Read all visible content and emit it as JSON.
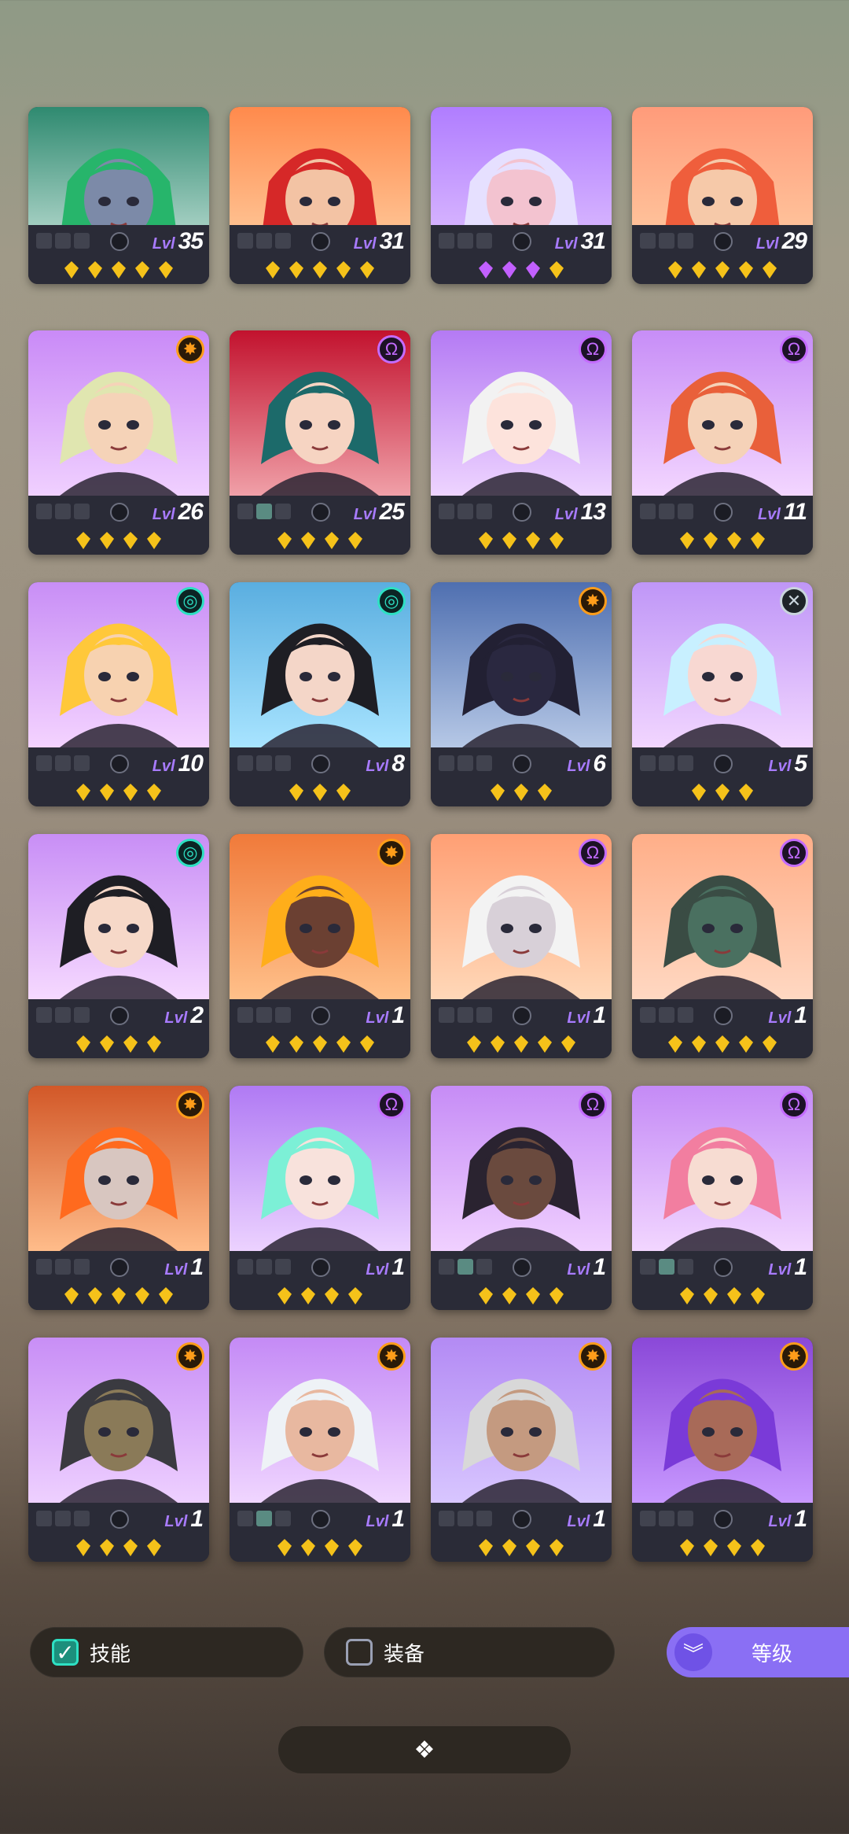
{
  "lvl_prefix": "Lvl",
  "cards": [
    {
      "level": "35",
      "faction": "none",
      "faction_icon": "",
      "stars": 5,
      "star_color": "#f5c21a",
      "gear": 0,
      "bg": [
        "#2f8a70",
        "#cfe8e0"
      ],
      "hair": "#27b56b",
      "skin": "#7c8aa8",
      "crop": true
    },
    {
      "level": "31",
      "faction": "none",
      "faction_icon": "",
      "stars": 5,
      "star_color": "#f5c21a",
      "gear": 0,
      "bg": [
        "#ff8a4c",
        "#ffd4a8"
      ],
      "hair": "#d62828",
      "skin": "#f3c3a4",
      "crop": true
    },
    {
      "level": "31",
      "faction": "none",
      "faction_icon": "",
      "stars": 4,
      "star_color": "mixed",
      "gear": 0,
      "bg": [
        "#b07dff",
        "#e3c6ff"
      ],
      "hair": "#e6e0ff",
      "skin": "#f3c3d0",
      "crop": true
    },
    {
      "level": "29",
      "faction": "none",
      "faction_icon": "",
      "stars": 5,
      "star_color": "#f5c21a",
      "gear": 0,
      "bg": [
        "#ff9b7a",
        "#ffd0a6"
      ],
      "hair": "#ef5e3c",
      "skin": "#f6c9a9",
      "crop": true
    },
    {
      "level": "26",
      "faction": "orange",
      "faction_icon": "✸",
      "stars": 4,
      "star_color": "#f5c21a",
      "gear": 0,
      "bg": [
        "#c98af7",
        "#f0d0ff"
      ],
      "hair": "#e0e6b0",
      "skin": "#f5d3b8"
    },
    {
      "level": "25",
      "faction": "purple",
      "faction_icon": "Ω",
      "stars": 4,
      "star_color": "#f5c21a",
      "gear": 2,
      "bg": [
        "#c2122e",
        "#f0a0a8"
      ],
      "hair": "#1c6a6a",
      "skin": "#f6d4c2"
    },
    {
      "level": "13",
      "faction": "purple",
      "faction_icon": "Ω",
      "stars": 4,
      "star_color": "#f5c21a",
      "gear": 0,
      "bg": [
        "#b47af4",
        "#eed4ff"
      ],
      "hair": "#f2f2f2",
      "skin": "#fde3dc"
    },
    {
      "level": "11",
      "faction": "purple",
      "faction_icon": "Ω",
      "stars": 4,
      "star_color": "#f5c21a",
      "gear": 0,
      "bg": [
        "#c78df7",
        "#f3d6ff"
      ],
      "hair": "#e9603a",
      "skin": "#f5d2b8"
    },
    {
      "level": "10",
      "faction": "teal",
      "faction_icon": "◎",
      "stars": 4,
      "star_color": "#f5c21a",
      "gear": 0,
      "bg": [
        "#c88ef6",
        "#f4d3ff"
      ],
      "hair": "#ffc83a",
      "skin": "#f7d2b0"
    },
    {
      "level": "8",
      "faction": "teal",
      "faction_icon": "◎",
      "stars": 3,
      "star_color": "#f5c21a",
      "gear": 0,
      "bg": [
        "#5aaee0",
        "#a8e4ff"
      ],
      "hair": "#1e1e24",
      "skin": "#f4d6c8"
    },
    {
      "level": "6",
      "faction": "orange",
      "faction_icon": "✸",
      "stars": 3,
      "star_color": "#f5c21a",
      "gear": 0,
      "bg": [
        "#4f6fb0",
        "#b6c8e6"
      ],
      "hair": "#222033",
      "skin": "#2a2840"
    },
    {
      "level": "5",
      "faction": "gray",
      "faction_icon": "✕",
      "stars": 3,
      "star_color": "#f5c21a",
      "gear": 0,
      "bg": [
        "#bf96f7",
        "#f2d6ff"
      ],
      "hair": "#c8f0ff",
      "skin": "#f8d8d2"
    },
    {
      "level": "2",
      "faction": "teal",
      "faction_icon": "◎",
      "stars": 4,
      "star_color": "#f5c21a",
      "gear": 0,
      "bg": [
        "#c88ef6",
        "#f6d9ff"
      ],
      "hair": "#1e1e24",
      "skin": "#f6d8c8"
    },
    {
      "level": "1",
      "faction": "orange",
      "faction_icon": "✸",
      "stars": 5,
      "star_color": "#f5c21a",
      "gear": 0,
      "bg": [
        "#f07a3a",
        "#ffc08a"
      ],
      "hair": "#ffae1a",
      "skin": "#6b4032"
    },
    {
      "level": "1",
      "faction": "purple",
      "faction_icon": "Ω",
      "stars": 5,
      "star_color": "#f5c21a",
      "gear": 0,
      "bg": [
        "#ff9f74",
        "#ffd8b8"
      ],
      "hair": "#f3f3f3",
      "skin": "#d8d0d8"
    },
    {
      "level": "1",
      "faction": "purple",
      "faction_icon": "Ω",
      "stars": 5,
      "star_color": "#f5c21a",
      "gear": 0,
      "bg": [
        "#ffae88",
        "#ffd8c2"
      ],
      "hair": "#3a4c44",
      "skin": "#4a7060"
    },
    {
      "level": "1",
      "faction": "orange",
      "faction_icon": "✸",
      "stars": 5,
      "star_color": "#f5c21a",
      "gear": 0,
      "bg": [
        "#d25828",
        "#ffbc8a"
      ],
      "hair": "#ff6a1e",
      "skin": "#d8c6c0"
    },
    {
      "level": "1",
      "faction": "purple",
      "faction_icon": "Ω",
      "stars": 4,
      "star_color": "#f5c21a",
      "gear": 0,
      "bg": [
        "#b07af4",
        "#ecd2ff"
      ],
      "hair": "#7cf0d6",
      "skin": "#f8e2dc"
    },
    {
      "level": "1",
      "faction": "purple",
      "faction_icon": "Ω",
      "stars": 4,
      "star_color": "#f5c21a",
      "gear": 2,
      "bg": [
        "#c68cf6",
        "#f0d0ff"
      ],
      "hair": "#2a2330",
      "skin": "#6a4a3e"
    },
    {
      "level": "1",
      "faction": "purple",
      "faction_icon": "Ω",
      "stars": 4,
      "star_color": "#f5c21a",
      "gear": 2,
      "bg": [
        "#c48af6",
        "#f2d6ff"
      ],
      "hair": "#f27ea0",
      "skin": "#f7dcd2"
    },
    {
      "level": "1",
      "faction": "orange",
      "faction_icon": "✸",
      "stars": 4,
      "star_color": "#f5c21a",
      "gear": 0,
      "bg": [
        "#c88ef6",
        "#eed0ff"
      ],
      "hair": "#3a3a40",
      "skin": "#8a7a58"
    },
    {
      "level": "1",
      "faction": "orange",
      "faction_icon": "✸",
      "stars": 4,
      "star_color": "#f5c21a",
      "gear": 2,
      "bg": [
        "#c48af6",
        "#f0d6ff"
      ],
      "hair": "#eef2f6",
      "skin": "#e8b8a0"
    },
    {
      "level": "1",
      "faction": "orange",
      "faction_icon": "✸",
      "stars": 4,
      "star_color": "#f5c21a",
      "gear": 0,
      "bg": [
        "#b38af4",
        "#d8c6ff"
      ],
      "hair": "#d8d8d8",
      "skin": "#c49a80"
    },
    {
      "level": "1",
      "faction": "orange",
      "faction_icon": "✸",
      "stars": 4,
      "star_color": "#f5c21a",
      "gear": 0,
      "bg": [
        "#8a48d8",
        "#c898ff"
      ],
      "hair": "#7a3ad8",
      "skin": "#a86a58"
    }
  ],
  "filters": {
    "skill_label": "技能",
    "skill_checked": true,
    "equip_label": "装备",
    "equip_checked": false
  },
  "sort": {
    "label": "等级",
    "icon": "double-chevron-down-icon"
  },
  "expand_handle": {
    "icon": "diamond-cluster-icon",
    "glyph": "❖"
  },
  "colors": {
    "accent": "#8a6ff4",
    "teal": "#2ee0c3",
    "star_gold": "#f5c21a",
    "star_purple": "#c260ff"
  }
}
